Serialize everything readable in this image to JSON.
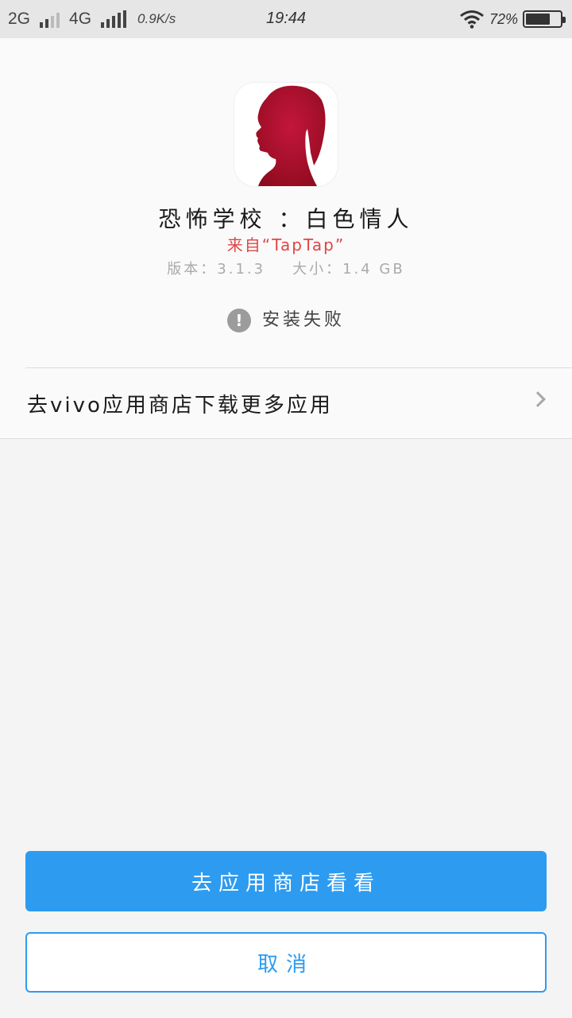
{
  "status_bar": {
    "network_1": "2G",
    "network_2": "4G",
    "speed": "0.9K/s",
    "time": "19:44",
    "battery_percent": "72%",
    "battery_level": 0.72,
    "icons": [
      "signal-icon",
      "wifi-icon",
      "battery-icon"
    ]
  },
  "app": {
    "name": "恐怖学校 ：白色情人",
    "source": "来自“TapTap”",
    "version_text": "版本：3.1.3",
    "size_text": "大小：1.4 GB",
    "icon": "app-icon-silhouette",
    "icon_color": "#b5102a"
  },
  "status": {
    "message": "安装失败",
    "icon": "alert-icon"
  },
  "store_link": {
    "label": "去vivo应用商店下载更多应用",
    "icon": "chevron-right-icon"
  },
  "buttons": {
    "primary_label": "去应用商店看看",
    "secondary_label": "取消",
    "accent_color": "#2d9bf0"
  }
}
